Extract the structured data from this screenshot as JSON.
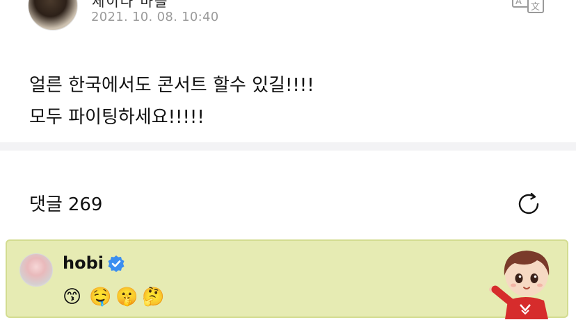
{
  "post": {
    "author_name": "세이나 마을",
    "timestamp": "2021. 10. 08. 10:40",
    "lines": [
      "얼른 한국에서도 콘서트 할수 있길!!!!",
      "모두 파이팅하세요!!!!!"
    ],
    "translate_icon": "translate-icon"
  },
  "comments": {
    "label": "댓글",
    "count": "269",
    "refresh_icon": "refresh-icon"
  },
  "highlighted_comment": {
    "username": "hobi",
    "verified_icon": "verified-badge-icon",
    "emojis": [
      "😙",
      "🤤",
      "🤫",
      "🤔"
    ],
    "sticker": "character-sticker"
  },
  "colors": {
    "highlight_bg": "#e6ebb3",
    "highlight_border": "#d3dc90",
    "verified": "#3b8ef0",
    "timestamp": "#9b9b9b",
    "divider": "#f3f3f5"
  }
}
